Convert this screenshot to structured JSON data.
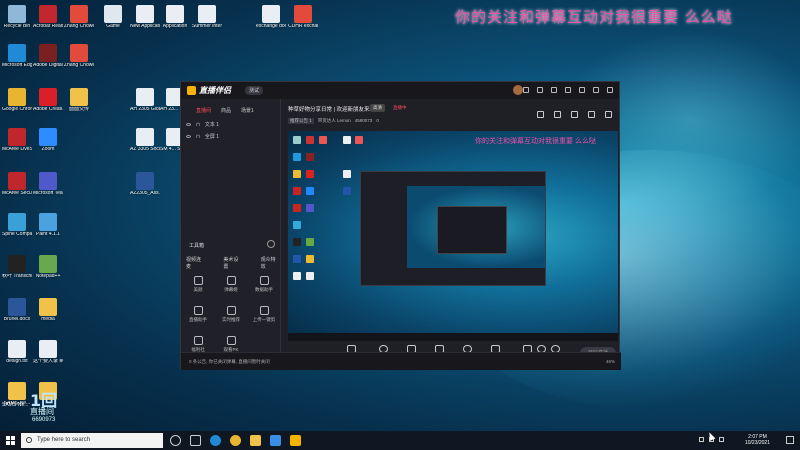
{
  "overlay_text": "你的关注和弹幕互动对我很重要 么么哒",
  "desktop_icons": [
    {
      "label": "Recycle Bin",
      "color": "#8fb7d8"
    },
    {
      "label": "Acrobat Reader DC",
      "color": "#c1272d"
    },
    {
      "label": "Zhang Chowei_Cri...",
      "color": "#e24a3b"
    },
    {
      "label": "Game",
      "color": "#dfe8ef"
    },
    {
      "label": "New Application",
      "color": "#e8eef3"
    },
    {
      "label": "Application",
      "color": "#e8eef3"
    },
    {
      "label": "Summer internship",
      "color": "#e8eef3"
    },
    {
      "label": "exchange doc",
      "color": "#e8eef3"
    },
    {
      "label": "CDHR exchange...",
      "color": "#e24a3b"
    },
    {
      "label": "Microsoft Edge",
      "color": "#1f8ad6"
    },
    {
      "label": "Adobe Digital Editions 4.5",
      "color": "#7a2020"
    },
    {
      "label": "Zhang Chowei_Re...",
      "color": "#e24a3b"
    },
    {
      "label": "Google Chrome",
      "color": "#e9b531"
    },
    {
      "label": "Adobe Creati...",
      "color": "#da1f26"
    },
    {
      "label": "面面交传",
      "color": "#f1c24a"
    },
    {
      "label": "AH 2305 Global Sou...",
      "color": "#e8eef3"
    },
    {
      "label": "AH 23... Sustainab...",
      "color": "#e8eef3"
    },
    {
      "label": "McAfee LiveSafe",
      "color": "#c0272d"
    },
    {
      "label": "Zoom",
      "color": "#2d8cff"
    },
    {
      "label": "AZ 3305 Social Psy...",
      "color": "#e8eef3"
    },
    {
      "label": "SM 4... Solutions",
      "color": "#e8eef3"
    },
    {
      "label": "McAfee Security Sc...",
      "color": "#c0272d"
    },
    {
      "label": "Microsoft Teams",
      "color": "#5059c9"
    },
    {
      "label": "AZ2305_Ass...",
      "color": "#2b579a"
    },
    {
      "label": "Spine Companion",
      "color": "#3aa0d8"
    },
    {
      "label": "Paint 4.1.1",
      "color": "#4aa3df"
    },
    {
      "label": "秋叶 Transcribe",
      "color": "#222222"
    },
    {
      "label": "Notepad++",
      "color": "#6aa84f"
    },
    {
      "label": "Brunei.docx",
      "color": "#2b579a"
    },
    {
      "label": "media",
      "color": "#f1c24a"
    },
    {
      "label": "design.txt",
      "color": "#e8eef3"
    },
    {
      "label": "这个要入录 制效果.mmds",
      "color": "#e8eef3"
    },
    {
      "label": "SAMS-Ne...",
      "color": "#f1c24a"
    },
    {
      "label": "",
      "color": "#f1c24a"
    }
  ],
  "app": {
    "name": "直播伴侣",
    "version": "测试",
    "left_tabs": [
      "直播间",
      "商品",
      "场景1"
    ],
    "scenes": [
      "文本 1",
      "全屏 1"
    ],
    "tools_title": "工具箱",
    "tool_row_labels": [
      "视频连麦",
      "美术设置",
      "观众特效"
    ],
    "tools": [
      "美颜",
      "弹幕姬",
      "数据助手",
      "直播助手",
      "实时推荐",
      "上传一键剪",
      "福利社",
      "观看PK"
    ],
    "stream_title": "种草好物分享日常 | 欢迎新朋友来玩",
    "tag": "高清",
    "tag2": "直播中",
    "meta": [
      "推荐公告 1",
      "带货达人 Lemon",
      "4590073",
      "0"
    ],
    "preview_text": "你的关注和弹幕互动对我很重要 么么哒",
    "bottom_buttons": [
      "直播屏幕",
      "摄像头",
      "手机投屏",
      "多媒体",
      "麦克风",
      "扬声器"
    ],
    "live_button": "开始直播",
    "status_text": "0 条公告, 你已关闭弹幕, 直播间暂时关闭",
    "status_right": "46%"
  },
  "watermark": {
    "line1": "1回",
    "line2": "直播间",
    "line3": "6690973",
    "label": "SAMS-Ne..."
  },
  "taskbar": {
    "search_placeholder": "Type here to search",
    "time": "2:07 PM",
    "date": "10/23/2021"
  }
}
